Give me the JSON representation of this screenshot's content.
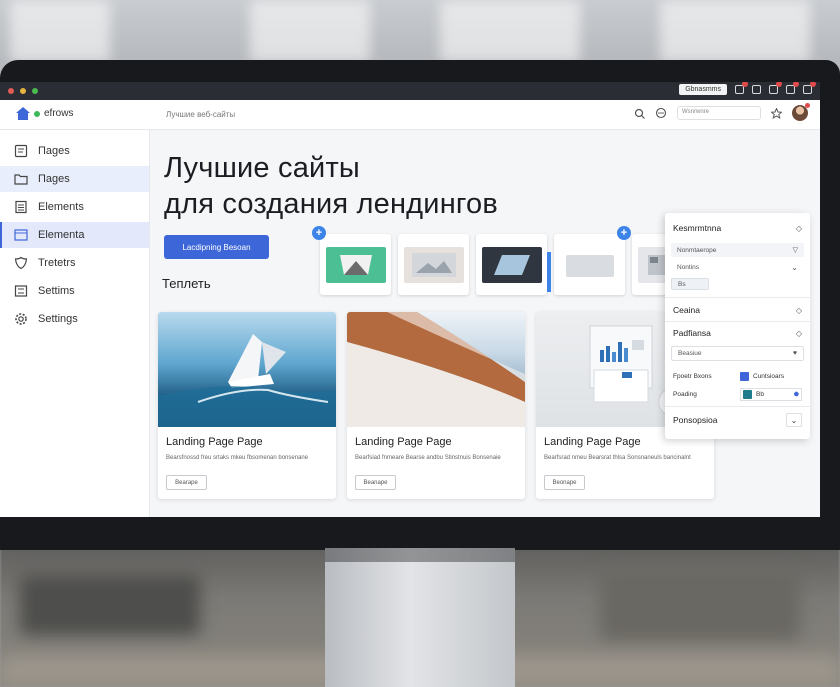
{
  "browser": {
    "top_button_label": "Gbnasmms"
  },
  "app": {
    "logo_text": "efrows",
    "breadcrumb": "Лучшие веб-сайты",
    "search_placeholder": "Wsnrwnre"
  },
  "sidebar": {
    "items": [
      {
        "label": "Пages",
        "icon": "pages-icon"
      },
      {
        "label": "Пages",
        "icon": "folder-icon"
      },
      {
        "label": "Elements",
        "icon": "list-icon"
      },
      {
        "label": "Elementa",
        "icon": "layout-icon"
      },
      {
        "label": "Tretetrs",
        "icon": "shield-icon"
      },
      {
        "label": "Settims",
        "icon": "sliders-icon"
      },
      {
        "label": "Settings",
        "icon": "gear-icon"
      }
    ]
  },
  "main": {
    "hero_line1": "Лучшие сайты",
    "hero_line2": "для создания лендингов",
    "cta_label": "Lacdipning Besoan",
    "section_label": "Теплеть",
    "cards": [
      {
        "title": "Landing Page Page",
        "desc": "Bearsfnossd freu srtaks mkeu fbsomenan bonsenane",
        "button": "Bearape"
      },
      {
        "title": "Landing Page Page",
        "desc": "Bearfsiad fnmeare Bearse andbu Stinstnuis Bonsenaie",
        "button": "Beanape"
      },
      {
        "title": "Landing Page Page",
        "desc": "Bearfsrad nmeu Bearsrat thlsa Sonsnaneuls bancinalnt",
        "button": "Beonape"
      }
    ]
  },
  "panel": {
    "section1": "Kesmrmtnna",
    "field1": "Nonmtaerope",
    "field2": "Nontins",
    "field3": "Bs",
    "section2": "Ceaina",
    "section3": "Padfiansa",
    "field4": "Beasiue",
    "prop1_label": "Fpoetr Bxons",
    "prop1_value": "Cuntsioars",
    "prop2_label": "Poading",
    "prop2_value": "Bb",
    "section4": "Ponsopsioa",
    "colors": {
      "swatch_blue": "#3f66d8",
      "swatch_teal": "#1f7c8c"
    }
  },
  "colors": {
    "accent": "#3d67d8",
    "plus_badge": "#3d84e8"
  }
}
